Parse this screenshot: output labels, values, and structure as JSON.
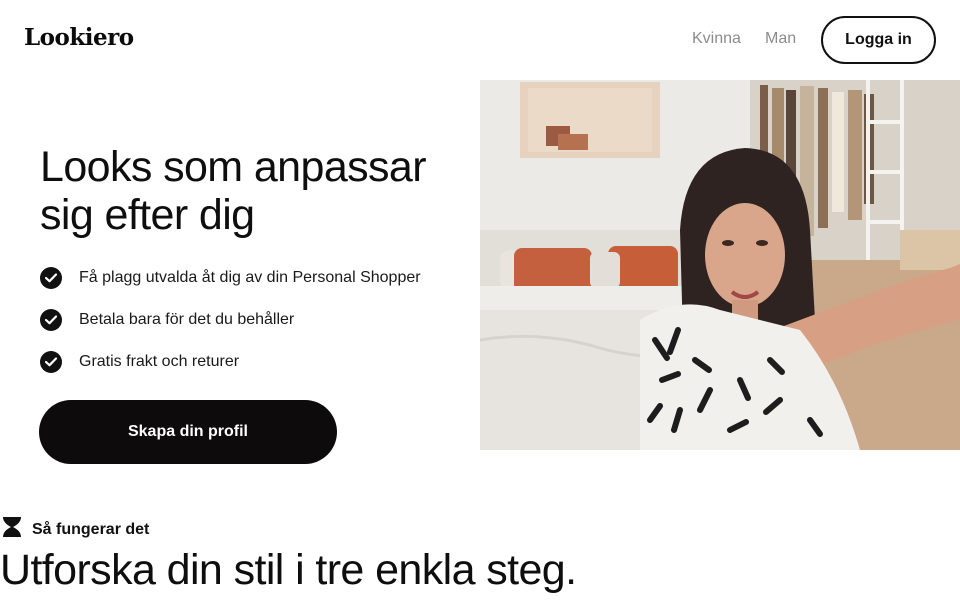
{
  "header": {
    "logo": "Lookiero",
    "nav": [
      {
        "label": "Kvinna"
      },
      {
        "label": "Man"
      }
    ],
    "login_label": "Logga in"
  },
  "hero": {
    "title_line1": "Looks som anpassar",
    "title_line2": "sig efter dig",
    "benefits": [
      {
        "text": "Få plagg utvalda åt dig av din Personal Shopper",
        "icon": "check-icon"
      },
      {
        "text": "Betala bara för det du behåller",
        "icon": "check-icon"
      },
      {
        "text": "Gratis frakt och returer",
        "icon": "check-icon"
      }
    ],
    "cta_label": "Skapa din profil",
    "image_icon": "hero-photo"
  },
  "how_it_works": {
    "label": "Så fungerar det",
    "icon": "hourglass-icon",
    "title": "Utforska din stil i tre enkla steg."
  },
  "colors": {
    "text": "#111111",
    "nav_muted": "#8c8c8c",
    "button_dark": "#0d0b0c",
    "background": "#ffffff"
  }
}
